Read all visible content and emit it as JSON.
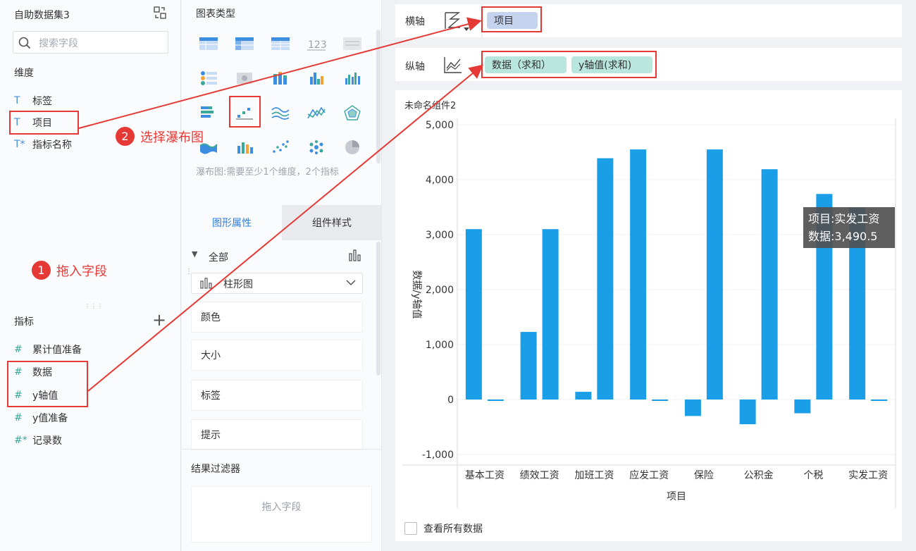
{
  "left": {
    "dataset_title": "自助数据集3",
    "search_placeholder": "搜索字段",
    "dimension_title": "维度",
    "dimensions": [
      {
        "type": "T",
        "label": "标签"
      },
      {
        "type": "T",
        "label": "项目"
      },
      {
        "type": "T*",
        "label": "指标名称"
      }
    ],
    "measure_title": "指标",
    "measures": [
      {
        "type": "#",
        "label": "累计值准备"
      },
      {
        "type": "#",
        "label": "数据"
      },
      {
        "type": "#",
        "label": "y轴值"
      },
      {
        "type": "#",
        "label": "y值准备"
      },
      {
        "type": "#*",
        "label": "记录数"
      }
    ]
  },
  "middle": {
    "chart_type_title": "图表类型",
    "chart_icons": [
      "table-icon",
      "cross-table-icon",
      "detail-table-icon",
      "kpi-number-icon",
      "text-table-icon",
      "grouped-table-icon",
      "map-icon",
      "stacked-bar-icon",
      "bar-icon",
      "column-icon",
      "horizontal-bar-icon",
      "waterfall-icon",
      "area-line-icon",
      "line-icon",
      "radar-icon",
      "range-area-icon",
      "combo-bar-icon",
      "scatter-icon",
      "bubble-icon",
      "pie-icon"
    ],
    "hint": "瀑布图:需要至少1个维度，2个指标",
    "tab_properties": "图形属性",
    "tab_style": "组件样式",
    "all_label": "全部",
    "chart_select": "柱形图",
    "props": [
      "颜色",
      "大小",
      "标签",
      "提示"
    ],
    "filter_title": "结果过滤器",
    "filter_placeholder": "拖入字段"
  },
  "axes": {
    "x_label": "横轴",
    "x_fields": [
      "项目"
    ],
    "y_label": "纵轴",
    "y_fields": [
      "数据（求和）",
      "y轴值(求和)"
    ]
  },
  "chart_card": {
    "title": "未命名组件2",
    "view_all": "查看所有数据"
  },
  "tooltip": {
    "line1": "项目:实发工资",
    "line2": "数据:3,490.5"
  },
  "annotations": {
    "step1": {
      "num": "1",
      "text": "拖入字段"
    },
    "step2": {
      "num": "2",
      "text": "选择瀑布图"
    }
  },
  "colors": {
    "bar": "#1a9ee8",
    "annotation": "#e53935",
    "accent": "#2f7fd9"
  },
  "chart_data": {
    "type": "bar",
    "categories": [
      "基本工资",
      "绩效工资",
      "加班工资",
      "应发工资",
      "保险",
      "公积金",
      "个税",
      "实发工资"
    ],
    "series": [
      {
        "values": [
          3100,
          1230,
          140,
          4550,
          -300,
          -450,
          -250,
          3490.5
        ]
      },
      {
        "values": [
          0,
          3100,
          4390,
          0,
          4550,
          4190,
          3740,
          0
        ]
      }
    ],
    "xlabel": "项目",
    "ylabel": "数据/y轴值",
    "ylim": [
      -1000,
      5000
    ],
    "yticks": [
      "5,000",
      "4,000",
      "3,000",
      "2,000",
      "1,000",
      "0",
      "-1,000"
    ]
  }
}
